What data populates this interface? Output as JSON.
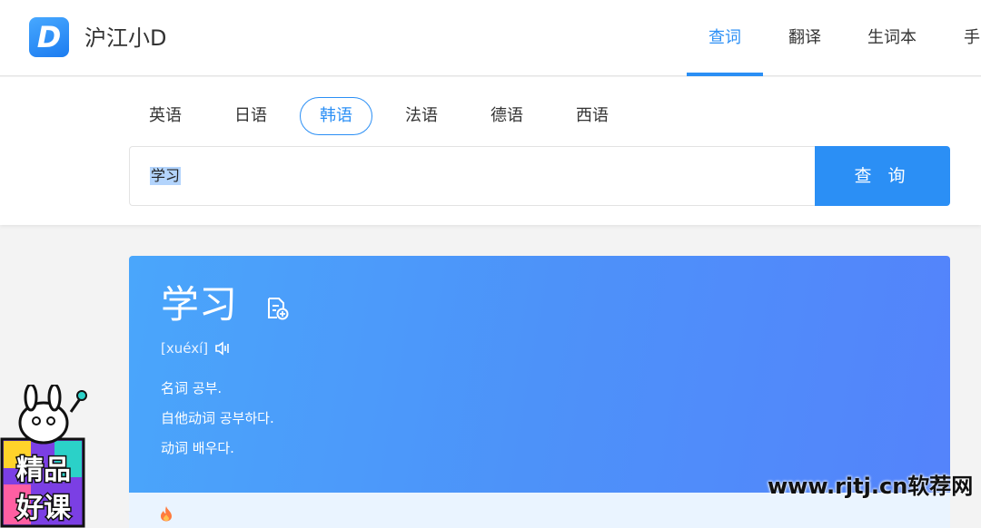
{
  "header": {
    "logo_letter": "D",
    "app_name": "沪江小D",
    "nav": [
      {
        "label": "查词",
        "active": true
      },
      {
        "label": "翻译",
        "active": false
      },
      {
        "label": "生词本",
        "active": false
      },
      {
        "label": "手"
      }
    ]
  },
  "search": {
    "languages": [
      "英语",
      "日语",
      "韩语",
      "法语",
      "德语",
      "西语"
    ],
    "active_language": "韩语",
    "query": "学习",
    "button_label": "查 询"
  },
  "result": {
    "word": "学习",
    "pronunciation": "[xuéxí]",
    "definitions": [
      "名词 공부.",
      "自他动词 공부하다.",
      "动词 배우다."
    ]
  },
  "overlay": {
    "badge_text": "精品好课",
    "watermark": "www.rjtj.cn软荐网"
  },
  "colors": {
    "accent": "#2b8ff5",
    "card_gradient_start": "#4aa6fb",
    "card_gradient_end": "#5483fb"
  }
}
